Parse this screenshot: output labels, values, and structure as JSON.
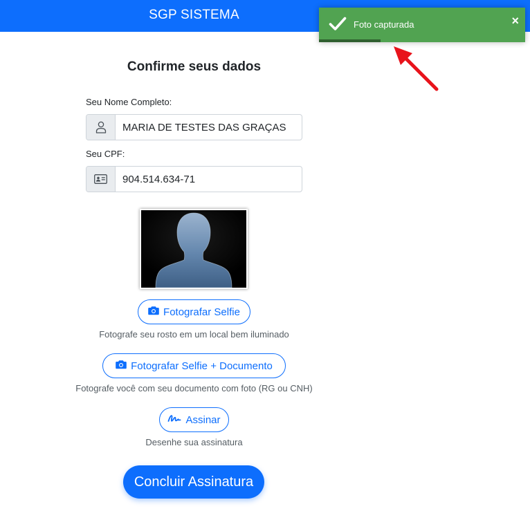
{
  "header": {
    "title": "SGP SISTEMA"
  },
  "page": {
    "title": "Confirme seus dados"
  },
  "form": {
    "name_label": "Seu Nome Completo:",
    "name_value": "MARIA DE TESTES DAS GRAÇAS",
    "cpf_label": "Seu CPF:",
    "cpf_value": "904.514.634-71"
  },
  "actions": {
    "selfie_label": "Fotografar Selfie",
    "selfie_hint": "Fotografe seu rosto em um local bem iluminado",
    "selfie_doc_label": "Fotografar Selfie + Documento",
    "selfie_doc_hint": "Fotografe você com seu documento com foto (RG ou CNH)",
    "sign_label": "Assinar",
    "sign_hint": "Desenhe sua assinatura",
    "finish_label": "Concluir Assinatura"
  },
  "toast": {
    "message": "Foto capturada",
    "close": "×",
    "progress": 0.3
  },
  "colors": {
    "primary": "#0d6efd",
    "success": "#51a351",
    "annotation_arrow": "#e8131b"
  }
}
